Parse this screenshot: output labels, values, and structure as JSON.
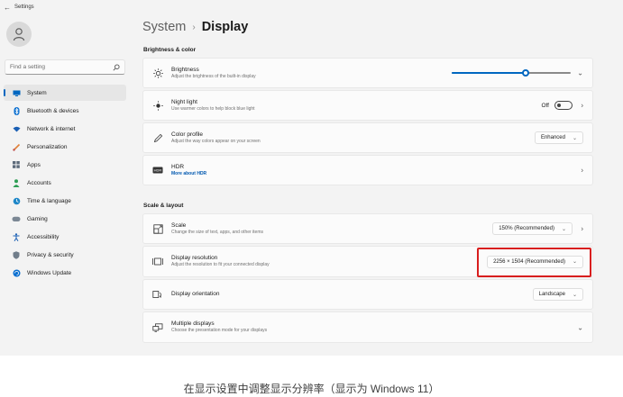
{
  "window": {
    "title": "Settings"
  },
  "sidebar": {
    "search_placeholder": "Find a setting",
    "items": [
      {
        "label": "System",
        "icon": "system-icon",
        "selected": true
      },
      {
        "label": "Bluetooth & devices",
        "icon": "bluetooth-icon"
      },
      {
        "label": "Network & internet",
        "icon": "wifi-icon"
      },
      {
        "label": "Personalization",
        "icon": "brush-icon"
      },
      {
        "label": "Apps",
        "icon": "apps-icon"
      },
      {
        "label": "Accounts",
        "icon": "person-icon"
      },
      {
        "label": "Time & language",
        "icon": "globe-clock-icon"
      },
      {
        "label": "Gaming",
        "icon": "gamepad-icon"
      },
      {
        "label": "Accessibility",
        "icon": "accessibility-icon"
      },
      {
        "label": "Privacy & security",
        "icon": "shield-icon"
      },
      {
        "label": "Windows Update",
        "icon": "update-icon"
      }
    ]
  },
  "header": {
    "crumb": "System",
    "separator": "›",
    "current": "Display"
  },
  "brightness_section": {
    "title": "Brightness & color",
    "brightness": {
      "title": "Brightness",
      "subtitle": "Adjust the brightness of the built-in display",
      "value_fraction": 0.62
    },
    "night_light": {
      "title": "Night light",
      "subtitle": "Use warmer colors to help block blue light",
      "state": "Off"
    },
    "color_profile": {
      "title": "Color profile",
      "subtitle": "Adjust the way colors appear on your screen",
      "value": "Enhanced"
    },
    "hdr": {
      "title": "HDR",
      "subtitle": "More about HDR"
    }
  },
  "scale_section": {
    "title": "Scale & layout",
    "scale": {
      "title": "Scale",
      "subtitle": "Change the size of text, apps, and other items",
      "value": "150% (Recommended)"
    },
    "resolution": {
      "title": "Display resolution",
      "subtitle": "Adjust the resolution to fit your connected display",
      "value": "2256 × 1504 (Recommended)"
    },
    "orientation": {
      "title": "Display orientation",
      "value": "Landscape"
    },
    "multiple": {
      "title": "Multiple displays",
      "subtitle": "Choose the presentation mode for your displays"
    }
  },
  "caption": "在显示设置中调整显示分辨率（显示为 Windows 11）",
  "colors": {
    "accent": "#0067c0",
    "highlight": "#d81e1e"
  }
}
